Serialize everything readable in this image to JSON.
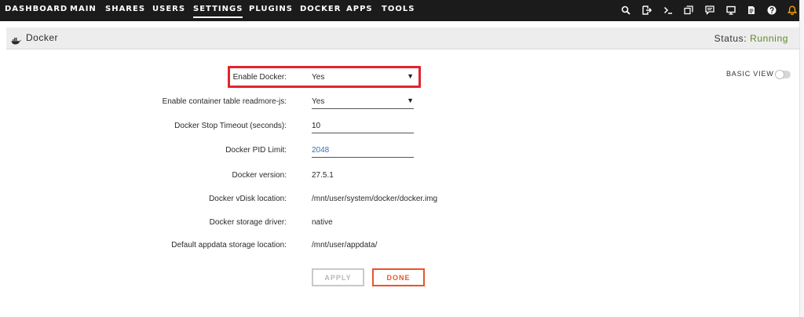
{
  "nav": {
    "items": [
      {
        "label": "DASHBOARD",
        "active": false
      },
      {
        "label": "MAIN",
        "active": false
      },
      {
        "label": "SHARES",
        "active": false
      },
      {
        "label": "USERS",
        "active": false
      },
      {
        "label": "SETTINGS",
        "active": true
      },
      {
        "label": "PLUGINS",
        "active": false
      },
      {
        "label": "DOCKER",
        "active": false
      },
      {
        "label": "APPS",
        "active": false
      },
      {
        "label": "TOOLS",
        "active": false
      }
    ],
    "icons": [
      "search-icon",
      "logout-icon",
      "terminal-icon",
      "copy-icon",
      "feedback-icon",
      "monitor-icon",
      "log-icon",
      "help-icon",
      "notification-bell-icon"
    ],
    "notification_color": "#f0a30a"
  },
  "header": {
    "title": "Docker",
    "status_label": "Status:",
    "status_value": "Running",
    "status_color": "#5a8a2b"
  },
  "view_toggle": {
    "label": "BASIC VIEW",
    "enabled": false
  },
  "form": {
    "enable_docker": {
      "label": "Enable Docker:",
      "value": "Yes"
    },
    "readmore": {
      "label": "Enable container table readmore-js:",
      "value": "Yes"
    },
    "stop_timeout": {
      "label": "Docker Stop Timeout (seconds):",
      "value": "10"
    },
    "pid_limit": {
      "label": "Docker PID Limit:",
      "placeholder": "2048"
    },
    "version": {
      "label": "Docker version:",
      "value": "27.5.1"
    },
    "vdisk": {
      "label": "Docker vDisk location:",
      "value": "/mnt/user/system/docker/docker.img"
    },
    "storage_driver": {
      "label": "Docker storage driver:",
      "value": "native"
    },
    "appdata": {
      "label": "Default appdata storage location:",
      "value": "/mnt/user/appdata/"
    }
  },
  "buttons": {
    "apply": "APPLY",
    "done": "DONE"
  },
  "colors": {
    "accent": "#e8562a",
    "highlight": "#e2242f",
    "link_value": "#3f6fb0"
  }
}
